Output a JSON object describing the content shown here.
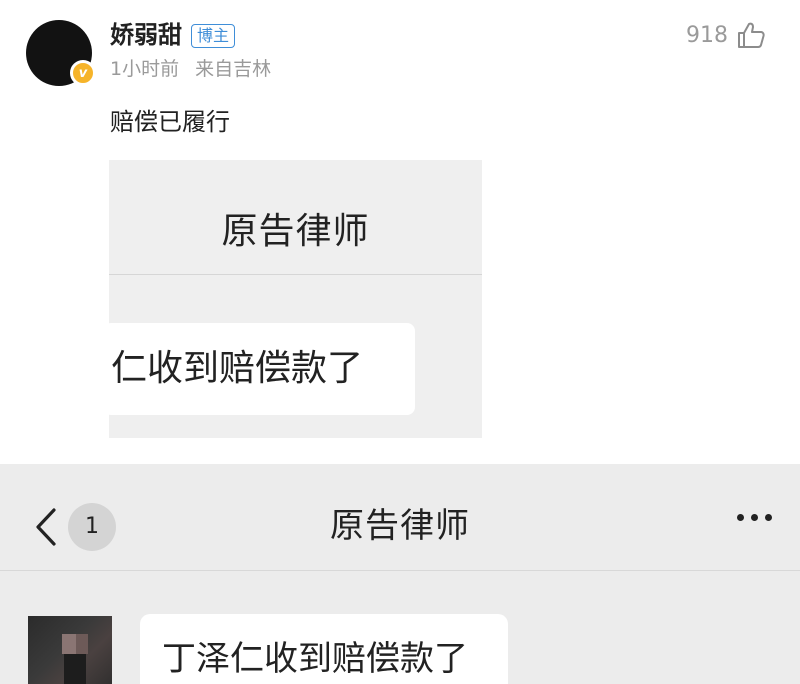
{
  "post": {
    "username": "娇弱甜",
    "role_badge": "博主",
    "verified_badge": "v",
    "time": "1小时前",
    "location": "来自吉林",
    "like_count": "918",
    "text": "赔偿已履行"
  },
  "embedded_crop": {
    "title": "原告律师",
    "message": "仁收到赔偿款了"
  },
  "screenshot": {
    "unread_count": "1",
    "title": "原告律师",
    "message": "丁泽仁收到赔偿款了"
  },
  "colors": {
    "badge_blue": "#3f8ed8",
    "verified_gold": "#f6b42a",
    "meta_gray": "#9a9a9a"
  },
  "icons": [
    "thumbs-up-icon",
    "back-chevron-icon",
    "more-dots-icon",
    "verified-icon"
  ]
}
